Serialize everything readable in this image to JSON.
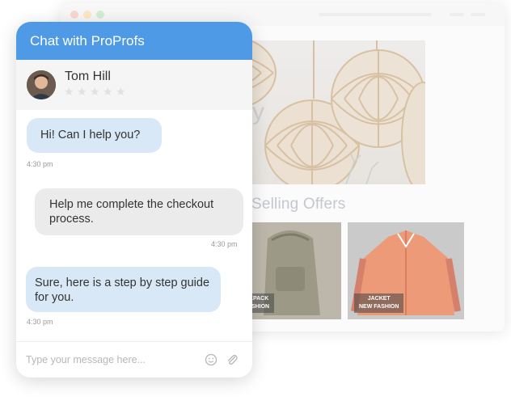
{
  "chat": {
    "title": "Chat with ProProfs",
    "agent_name": "Tom Hill",
    "rating": 0,
    "rating_max": 5,
    "messages": [
      {
        "from": "agent",
        "text": "Hi! Can I help you?",
        "time": "4:30 pm"
      },
      {
        "from": "user",
        "text": "Help me complete the checkout process.",
        "time": "4:30 pm"
      },
      {
        "from": "agent",
        "text": "Sure, here is a step by step guide for you.",
        "time": "4:30 pm"
      }
    ],
    "input_placeholder": "Type your message here...",
    "icons": {
      "emoji": "smiley-icon",
      "attach": "paperclip-icon"
    }
  },
  "background_site": {
    "hero_partial_text": "y",
    "section_title": "Selling Offers",
    "products": [
      {
        "tag_line1": "CKPACK",
        "tag_line2": "FASHION"
      },
      {
        "tag_line1": "JACKET",
        "tag_line2": "NEW FASHION"
      }
    ]
  },
  "colors": {
    "header": "#4f9ae6",
    "agent_bubble": "#d8e8f7",
    "user_bubble": "#ebebeb"
  }
}
